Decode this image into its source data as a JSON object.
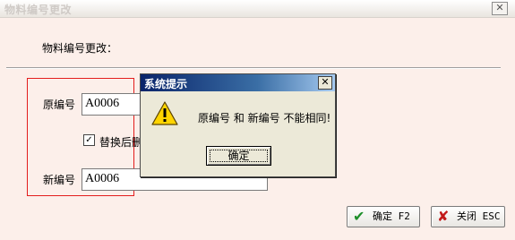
{
  "window": {
    "title": "物料编号更改",
    "close_glyph": "✕"
  },
  "form": {
    "section_label": "物料编号更改：",
    "old_code_label": "原编号",
    "old_code_value": "A0006",
    "replace_checkbox_label": "替换后删",
    "replace_checked": true,
    "new_code_label": "新编号",
    "new_code_value": "A0006"
  },
  "buttons": {
    "confirm_label": "确定 F2",
    "close_label": "关闭 ESC"
  },
  "dialog": {
    "title": "系统提示",
    "close_glyph": "✕",
    "message": "原编号 和 新编号 不能相同!",
    "ok_label": "确定",
    "icon": "warning-icon"
  },
  "colors": {
    "background": "#fcefea",
    "highlight_frame": "#e31d1d",
    "dialog_title_start": "#0a246a",
    "dialog_title_end": "#a6caf0",
    "confirm_icon": "#1d8f2a",
    "close_icon": "#c21a1a"
  }
}
